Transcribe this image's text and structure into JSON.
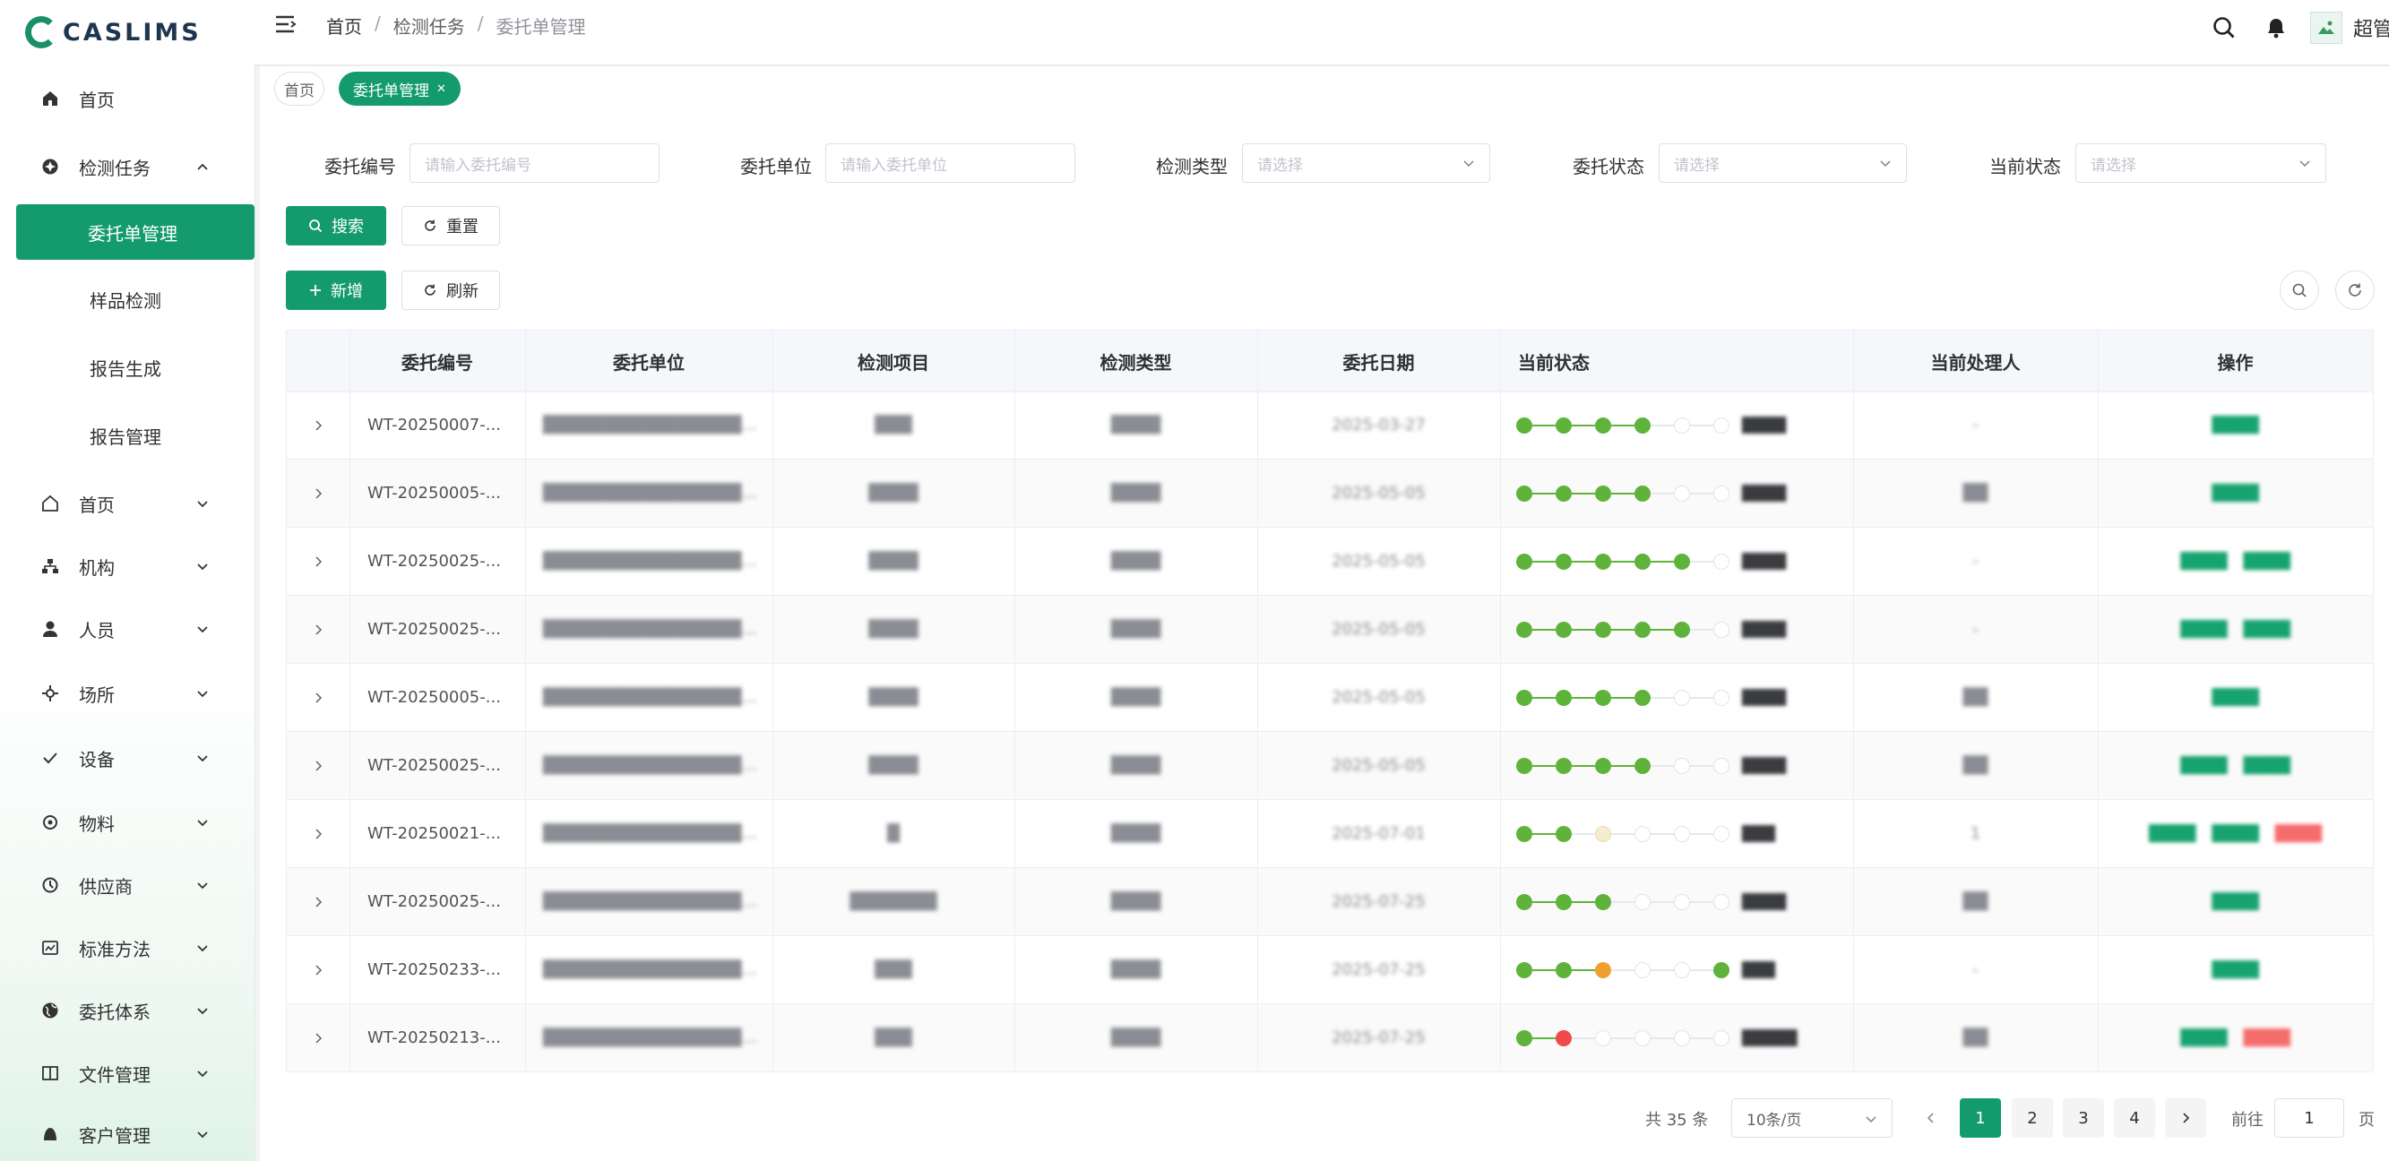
{
  "app": {
    "logo_text": "CASLIMS",
    "user_name": "超管"
  },
  "breadcrumb": [
    "首页",
    "检测任务",
    "委托单管理"
  ],
  "tags": {
    "home": "首页",
    "current": "委托单管理"
  },
  "sidebar": {
    "items": [
      {
        "label": "首页",
        "icon": "home-icon"
      },
      {
        "label": "检测任务",
        "icon": "task-icon",
        "expanded": true
      },
      {
        "label": "首页",
        "icon": "house-icon"
      },
      {
        "label": "机构",
        "icon": "org-icon"
      },
      {
        "label": "人员",
        "icon": "person-icon"
      },
      {
        "label": "场所",
        "icon": "place-icon"
      },
      {
        "label": "设备",
        "icon": "check-icon"
      },
      {
        "label": "物料",
        "icon": "material-icon"
      },
      {
        "label": "供应商",
        "icon": "supplier-icon"
      },
      {
        "label": "标准方法",
        "icon": "standard-icon"
      },
      {
        "label": "委托体系",
        "icon": "globe-icon"
      },
      {
        "label": "文件管理",
        "icon": "book-icon"
      },
      {
        "label": "客户管理",
        "icon": "customer-icon"
      }
    ],
    "sub_items": [
      {
        "label": "委托单管理",
        "active": true
      },
      {
        "label": "样品检测"
      },
      {
        "label": "报告生成"
      },
      {
        "label": "报告管理"
      }
    ]
  },
  "filters": {
    "commission_no": {
      "label": "委托编号",
      "placeholder": "请输入委托编号"
    },
    "commission_unit": {
      "label": "委托单位",
      "placeholder": "请输入委托单位"
    },
    "test_type": {
      "label": "检测类型",
      "placeholder": "请选择"
    },
    "commission_status": {
      "label": "委托状态",
      "placeholder": "请选择"
    },
    "current_status": {
      "label": "当前状态",
      "placeholder": "请选择"
    }
  },
  "buttons": {
    "search": "搜索",
    "reset": "重置",
    "add": "新增",
    "refresh": "刷新"
  },
  "table": {
    "columns": [
      "委托编号",
      "委托单位",
      "检测项目",
      "检测类型",
      "委托日期",
      "当前状态",
      "当前处理人",
      "操作"
    ],
    "rows": [
      {
        "no": "WT-20250007-...",
        "unit": "████████████████...",
        "item": "███",
        "type": "████",
        "date": "2025-03-27",
        "steps": [
          "done",
          "done",
          "done",
          "done",
          "todo",
          "todo"
        ],
        "status": "████",
        "handler": "-",
        "ops": [
          "green"
        ]
      },
      {
        "no": "WT-20250005-...",
        "unit": "████████████████...",
        "item": "████",
        "type": "████",
        "date": "2025-05-05",
        "steps": [
          "done",
          "done",
          "done",
          "done",
          "todo",
          "todo"
        ],
        "status": "████",
        "handler": "██",
        "ops": [
          "green"
        ]
      },
      {
        "no": "WT-20250025-...",
        "unit": "████████████████...",
        "item": "████",
        "type": "████",
        "date": "2025-05-05",
        "steps": [
          "done",
          "done",
          "done",
          "done",
          "done",
          "todo"
        ],
        "status": "████",
        "handler": "-",
        "ops": [
          "green",
          "green"
        ]
      },
      {
        "no": "WT-20250025-...",
        "unit": "████████████████...",
        "item": "████",
        "type": "████",
        "date": "2025-05-05",
        "steps": [
          "done",
          "done",
          "done",
          "done",
          "done",
          "todo"
        ],
        "status": "████",
        "handler": "-",
        "ops": [
          "green",
          "green"
        ]
      },
      {
        "no": "WT-20250005-...",
        "unit": "████████████████...",
        "item": "████",
        "type": "████",
        "date": "2025-05-05",
        "steps": [
          "done",
          "done",
          "done",
          "done",
          "todo",
          "todo"
        ],
        "status": "████",
        "handler": "██",
        "ops": [
          "green"
        ]
      },
      {
        "no": "WT-20250025-...",
        "unit": "████████████████...",
        "item": "████",
        "type": "████",
        "date": "2025-05-05",
        "steps": [
          "done",
          "done",
          "done",
          "done",
          "todo",
          "todo"
        ],
        "status": "████",
        "handler": "██",
        "ops": [
          "green",
          "green"
        ]
      },
      {
        "no": "WT-20250021-...",
        "unit": "████████████████...",
        "item": "█",
        "type": "████",
        "date": "2025-07-01",
        "steps": [
          "done",
          "done",
          "cur",
          "todo",
          "todo",
          "todo"
        ],
        "status": "███",
        "handler": "1",
        "ops": [
          "green",
          "green",
          "red"
        ]
      },
      {
        "no": "WT-20250025-...",
        "unit": "████████████████...",
        "item": "███████",
        "type": "████",
        "date": "2025-07-25",
        "steps": [
          "done",
          "done",
          "done",
          "todo",
          "todo",
          "todo"
        ],
        "status": "████",
        "handler": "██",
        "ops": [
          "green"
        ]
      },
      {
        "no": "WT-20250233-...",
        "unit": "████████████████...",
        "item": "███",
        "type": "████",
        "date": "2025-07-25",
        "steps": [
          "done",
          "done",
          "warn",
          "todo",
          "todo",
          "done"
        ],
        "status": "███",
        "handler": "-",
        "ops": [
          "green"
        ]
      },
      {
        "no": "WT-20250213-...",
        "unit": "████████████████...",
        "item": "███",
        "type": "████",
        "date": "2025-07-25",
        "steps": [
          "done",
          "fail",
          "todo",
          "todo",
          "todo",
          "todo"
        ],
        "status": "█████",
        "handler": "██",
        "ops": [
          "green",
          "red"
        ]
      }
    ]
  },
  "pagination": {
    "total_text": "共 35 条",
    "page_size": "10条/页",
    "pages": [
      "1",
      "2",
      "3",
      "4"
    ],
    "current_page": 1,
    "jump_label": "前往",
    "jump_value": "1",
    "jump_suffix": "页"
  },
  "colors": {
    "primary": "#149b6d",
    "done": "#5fb33b",
    "warn": "#f0a030",
    "fail": "#ef4a4a",
    "danger_text": "#f56c6c"
  }
}
